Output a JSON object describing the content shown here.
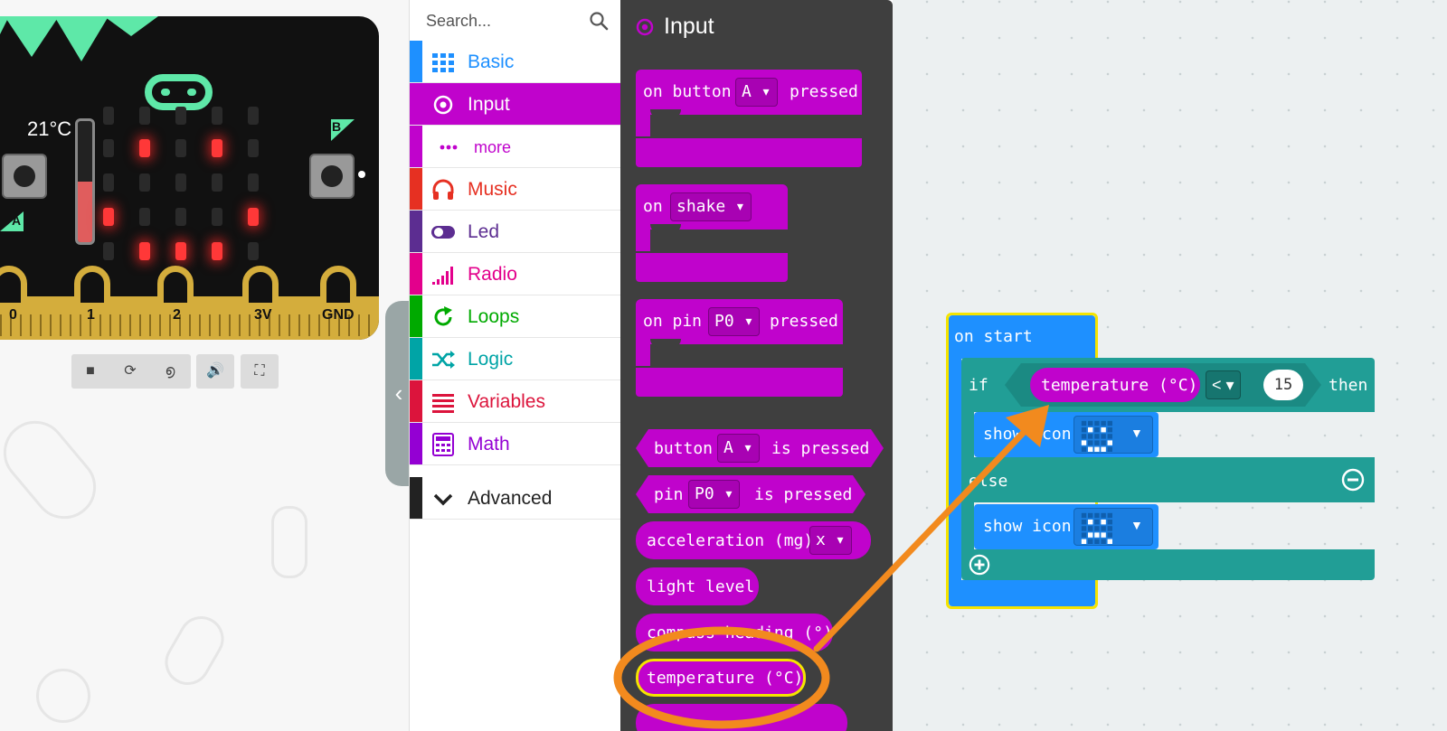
{
  "simulator": {
    "temperature_label": "21°C",
    "temperature_level": 0.5,
    "button_a_label": "A",
    "button_b_label": "B",
    "pins": [
      "0",
      "1",
      "2",
      "3V",
      "GND"
    ],
    "controls": [
      {
        "name": "stop-icon",
        "glyph": "■"
      },
      {
        "name": "restart-icon",
        "glyph": "⟳"
      },
      {
        "name": "slow-mo-icon",
        "glyph": "൭"
      },
      {
        "name": "sound-icon",
        "glyph": "🔊"
      },
      {
        "name": "fullscreen-icon",
        "glyph": "⛶"
      }
    ],
    "led_matrix": [
      [
        0,
        0,
        0,
        0,
        0
      ],
      [
        0,
        1,
        0,
        1,
        0
      ],
      [
        0,
        0,
        0,
        0,
        0
      ],
      [
        1,
        0,
        0,
        0,
        1
      ],
      [
        0,
        1,
        1,
        1,
        0
      ]
    ],
    "collapse_glyph": "‹"
  },
  "toolbox": {
    "search_placeholder": "Search...",
    "categories": [
      {
        "label": "Basic",
        "color": "#1e90ff",
        "icon": "grid-icon"
      },
      {
        "label": "Input",
        "color": "#c003cc",
        "icon": "target-icon",
        "selected": true
      },
      {
        "label": "more",
        "color": "#c003cc",
        "icon": "ellipsis-icon"
      },
      {
        "label": "Music",
        "color": "#e63022",
        "icon": "headphones-icon"
      },
      {
        "label": "Led",
        "color": "#5c2d91",
        "icon": "toggle-icon"
      },
      {
        "label": "Radio",
        "color": "#e3008c",
        "icon": "signal-icon"
      },
      {
        "label": "Loops",
        "color": "#00aa00",
        "icon": "refresh-icon"
      },
      {
        "label": "Logic",
        "color": "#00a4a6",
        "icon": "shuffle-icon"
      },
      {
        "label": "Variables",
        "color": "#dc143c",
        "icon": "list-icon"
      },
      {
        "label": "Math",
        "color": "#9400d3",
        "icon": "calculator-icon"
      },
      {
        "label": "Advanced",
        "color": "#222222",
        "icon": "chevron-down-icon"
      }
    ]
  },
  "flyout": {
    "title": "Input",
    "accent": "#c003cc",
    "blocks": {
      "on_button": {
        "pre": "on button",
        "opt": "A",
        "post": "pressed"
      },
      "on_shake": {
        "pre": "on",
        "opt": "shake"
      },
      "on_pin": {
        "pre": "on pin",
        "opt": "P0",
        "post": "pressed"
      },
      "button_is_pressed": {
        "pre": "button",
        "opt": "A",
        "post": "is pressed"
      },
      "pin_is_pressed": {
        "pre": "pin",
        "opt": "P0",
        "post": "is pressed"
      },
      "acceleration": {
        "pre": "acceleration (mg)",
        "opt": "x"
      },
      "light_level": "light level",
      "compass_heading": "compass heading (°)",
      "temperature": "temperature (°C)"
    }
  },
  "workspace": {
    "on_start": "on start",
    "if_kw": "if",
    "then_kw": "then",
    "else_kw": "else",
    "temperature": "temperature (°C)",
    "operator": "<",
    "threshold": "15",
    "show_icon_1": "show icon",
    "show_icon_2": "show icon"
  },
  "annotation": {
    "color": "#f28a1e",
    "highlight": "#f5e400"
  }
}
